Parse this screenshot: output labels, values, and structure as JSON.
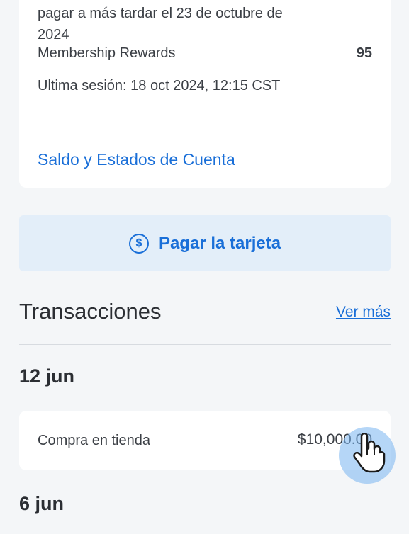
{
  "summary": {
    "due_text": "pagar a más tardar el 23 de octubre de 2024",
    "membership_label": "Membership Rewards",
    "membership_value": "95",
    "last_session": "Ultima sesión: 18 oct 2024, 12:15 CST",
    "statements_link": "Saldo y Estados de Cuenta"
  },
  "pay_button": {
    "label": "Pagar la tarjeta",
    "icon": "dollar-circle-icon",
    "icon_glyph": "$"
  },
  "transactions": {
    "title": "Transacciones",
    "see_more": "Ver más",
    "groups": [
      {
        "date": "12 jun",
        "items": [
          {
            "description": "Compra en tienda",
            "amount": "$10,000.00"
          }
        ]
      },
      {
        "date": "6 jun",
        "items": []
      }
    ]
  },
  "colors": {
    "accent": "#1a6fd8",
    "pay_button_bg": "#e3eef9",
    "background": "#f4f6f8"
  }
}
